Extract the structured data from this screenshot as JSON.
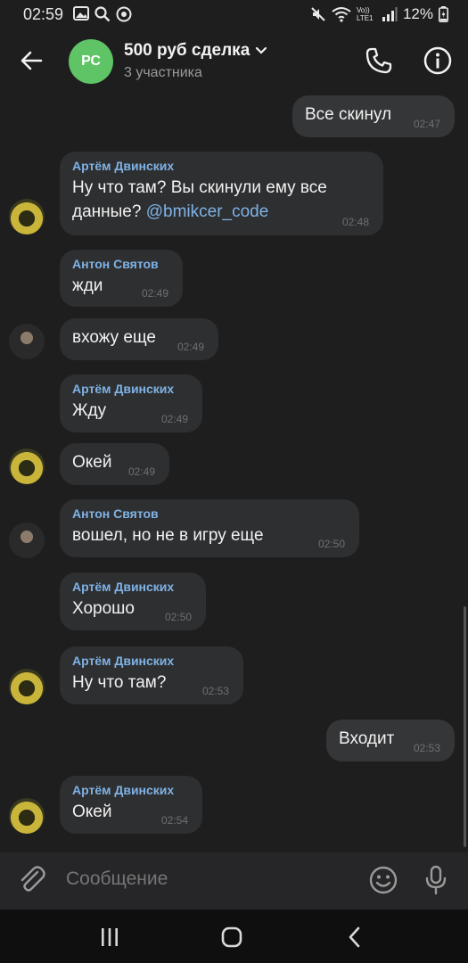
{
  "status_bar": {
    "time": "02:59",
    "network_label": "Vo)) LTE1",
    "battery_percent": "12%"
  },
  "header": {
    "avatar_initials": "РС",
    "avatar_color": "#5fc466",
    "title": "500 руб сделка",
    "subtitle": "3 участника"
  },
  "messages": [
    {
      "direction": "out",
      "text": "Все скинул",
      "time": "02:47"
    },
    {
      "direction": "in",
      "sender": "Артём Двинских",
      "text": "Ну что там? Вы скинули ему все данные?",
      "mention": "@bmikcer_code",
      "time": "02:48"
    },
    {
      "direction": "in",
      "sender": "Антон Святов",
      "text": "жди",
      "time": "02:49"
    },
    {
      "direction": "in",
      "sender": "",
      "text": "вхожу еще",
      "time": "02:49"
    },
    {
      "direction": "in",
      "sender": "Артём Двинских",
      "text": "Жду",
      "time": "02:49"
    },
    {
      "direction": "in",
      "sender": "",
      "text": "Окей",
      "time": "02:49"
    },
    {
      "direction": "in",
      "sender": "Антон Святов",
      "text": "вошел, но не в игру еще",
      "time": "02:50"
    },
    {
      "direction": "in",
      "sender": "Артём Двинских",
      "text": "Хорошо",
      "time": "02:50"
    },
    {
      "direction": "in",
      "sender": "Артём Двинских",
      "text": "Ну что там?",
      "time": "02:53"
    },
    {
      "direction": "out",
      "text": "Входит",
      "time": "02:53"
    },
    {
      "direction": "in",
      "sender": "Артём Двинских",
      "text": "Окей",
      "time": "02:54"
    }
  ],
  "composer": {
    "placeholder": "Сообщение"
  },
  "colors": {
    "background": "#1e1e1f",
    "bubble_in": "#2e2f31",
    "bubble_out": "#353638",
    "sender_name": "#7fb2e5",
    "accent": "#7fb2e5"
  },
  "icons": [
    "gallery-icon",
    "search-icon",
    "app-icon",
    "mute-icon",
    "wifi-icon",
    "signal-icon",
    "battery-icon",
    "back-arrow-icon",
    "phone-icon",
    "info-icon",
    "paperclip-icon",
    "emoji-icon",
    "microphone-icon",
    "recent-apps-icon",
    "home-icon",
    "nav-back-icon"
  ]
}
